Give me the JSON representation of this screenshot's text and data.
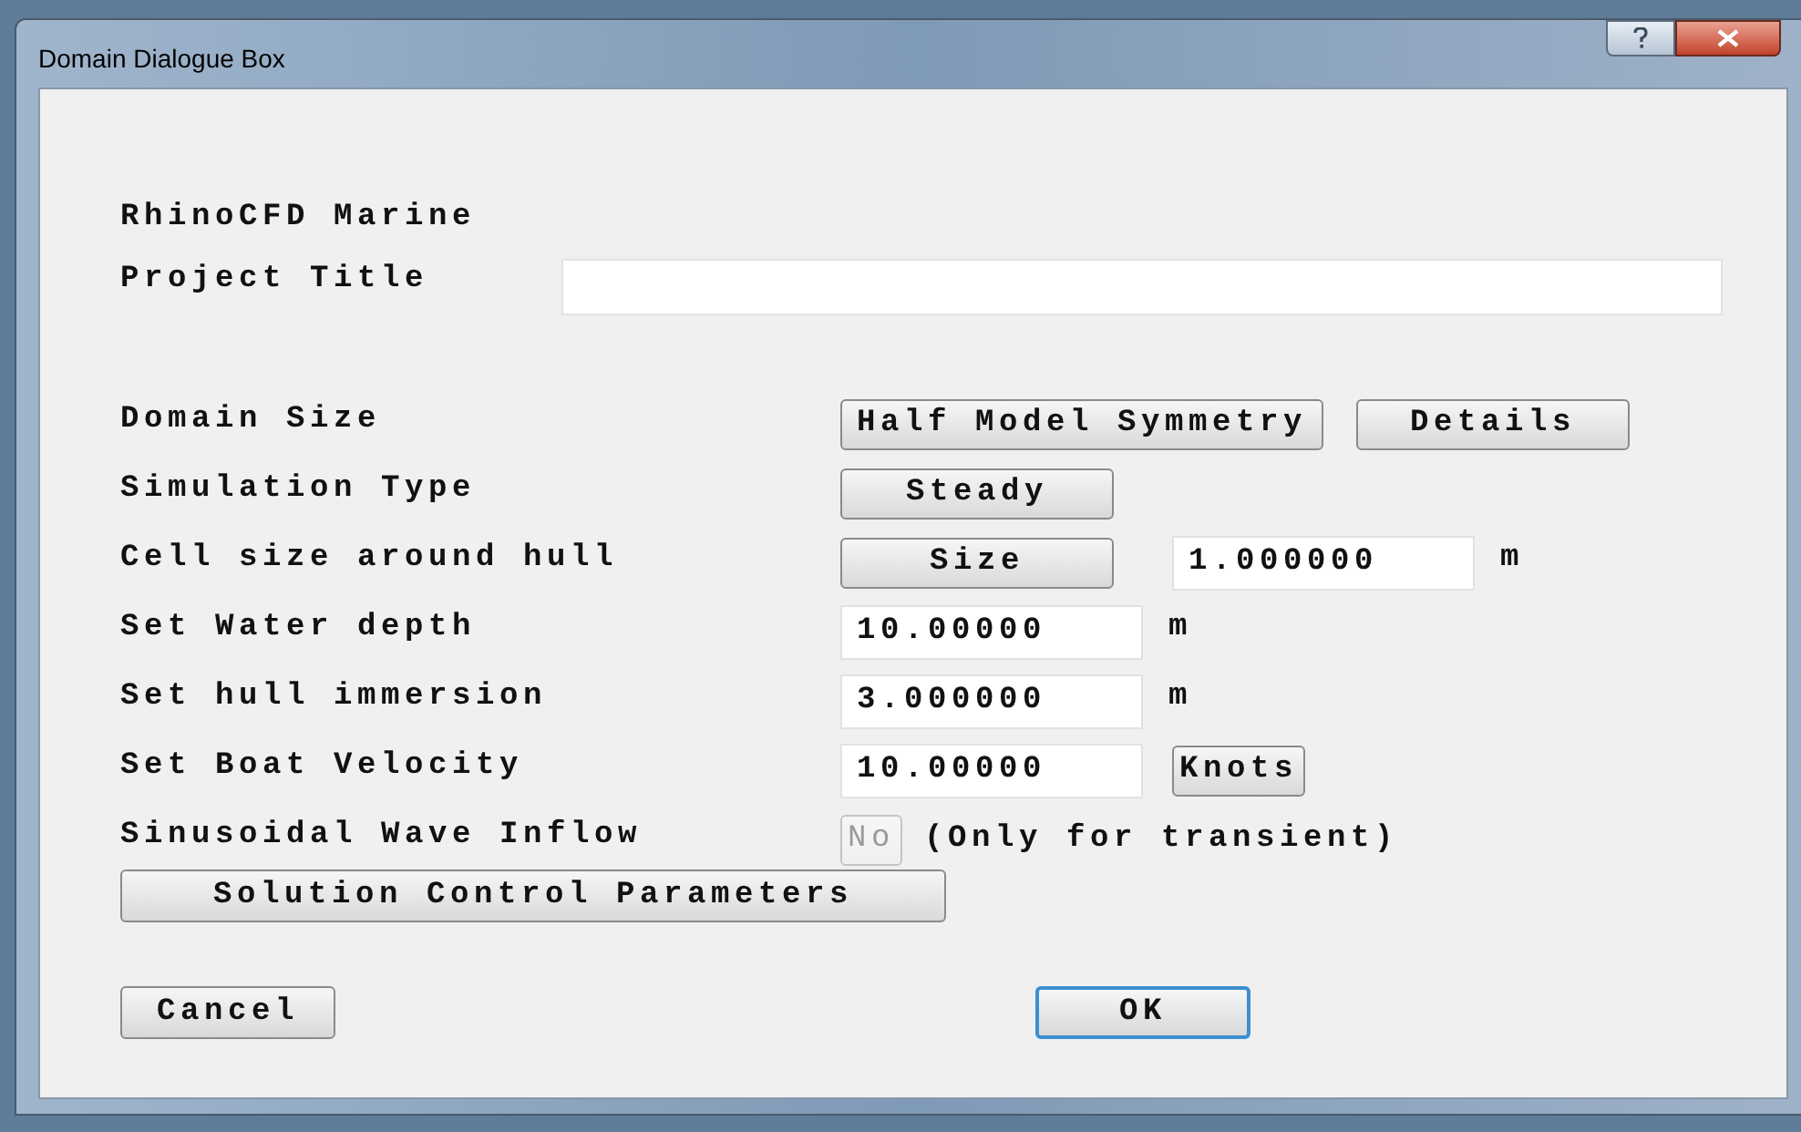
{
  "window": {
    "title": "Domain Dialogue Box"
  },
  "heading": "RhinoCFD Marine",
  "project_title": {
    "label": "Project Title"
  },
  "rows": [
    {
      "label": "Domain Size",
      "controls": [
        {
          "kind": "button",
          "text": "Half Model Symmetry",
          "disabled": false
        },
        {
          "kind": "button",
          "text": "Details",
          "disabled": false
        }
      ]
    },
    {
      "label": "Simulation Type",
      "controls": [
        {
          "kind": "button",
          "text": "Steady",
          "disabled": false
        }
      ]
    },
    {
      "label": "Cell size around hull",
      "controls": [
        {
          "kind": "button",
          "text": "Size",
          "disabled": false
        },
        {
          "kind": "field",
          "text": "1.000000"
        },
        {
          "kind": "unit",
          "text": "m"
        }
      ]
    },
    {
      "label": "Set Water depth",
      "controls": [
        {
          "kind": "field",
          "text": "10.00000"
        },
        {
          "kind": "unit",
          "text": "m"
        }
      ]
    },
    {
      "label": "Set hull immersion",
      "controls": [
        {
          "kind": "field",
          "text": "3.000000"
        },
        {
          "kind": "unit",
          "text": "m"
        }
      ]
    },
    {
      "label": "Set Boat Velocity",
      "controls": [
        {
          "kind": "field",
          "text": "10.00000"
        },
        {
          "kind": "compact-button",
          "text": "Knots",
          "disabled": false
        }
      ]
    },
    {
      "label": "Sinusoidal Wave Inflow",
      "controls": [
        {
          "kind": "compact-button",
          "text": "No",
          "disabled": true
        },
        {
          "kind": "note",
          "text": "(Only for transient)"
        }
      ]
    }
  ],
  "solution_button": "Solution Control Parameters",
  "footer": [
    {
      "text": "Cancel",
      "default": false
    },
    {
      "text": "OK",
      "default": true
    }
  ]
}
